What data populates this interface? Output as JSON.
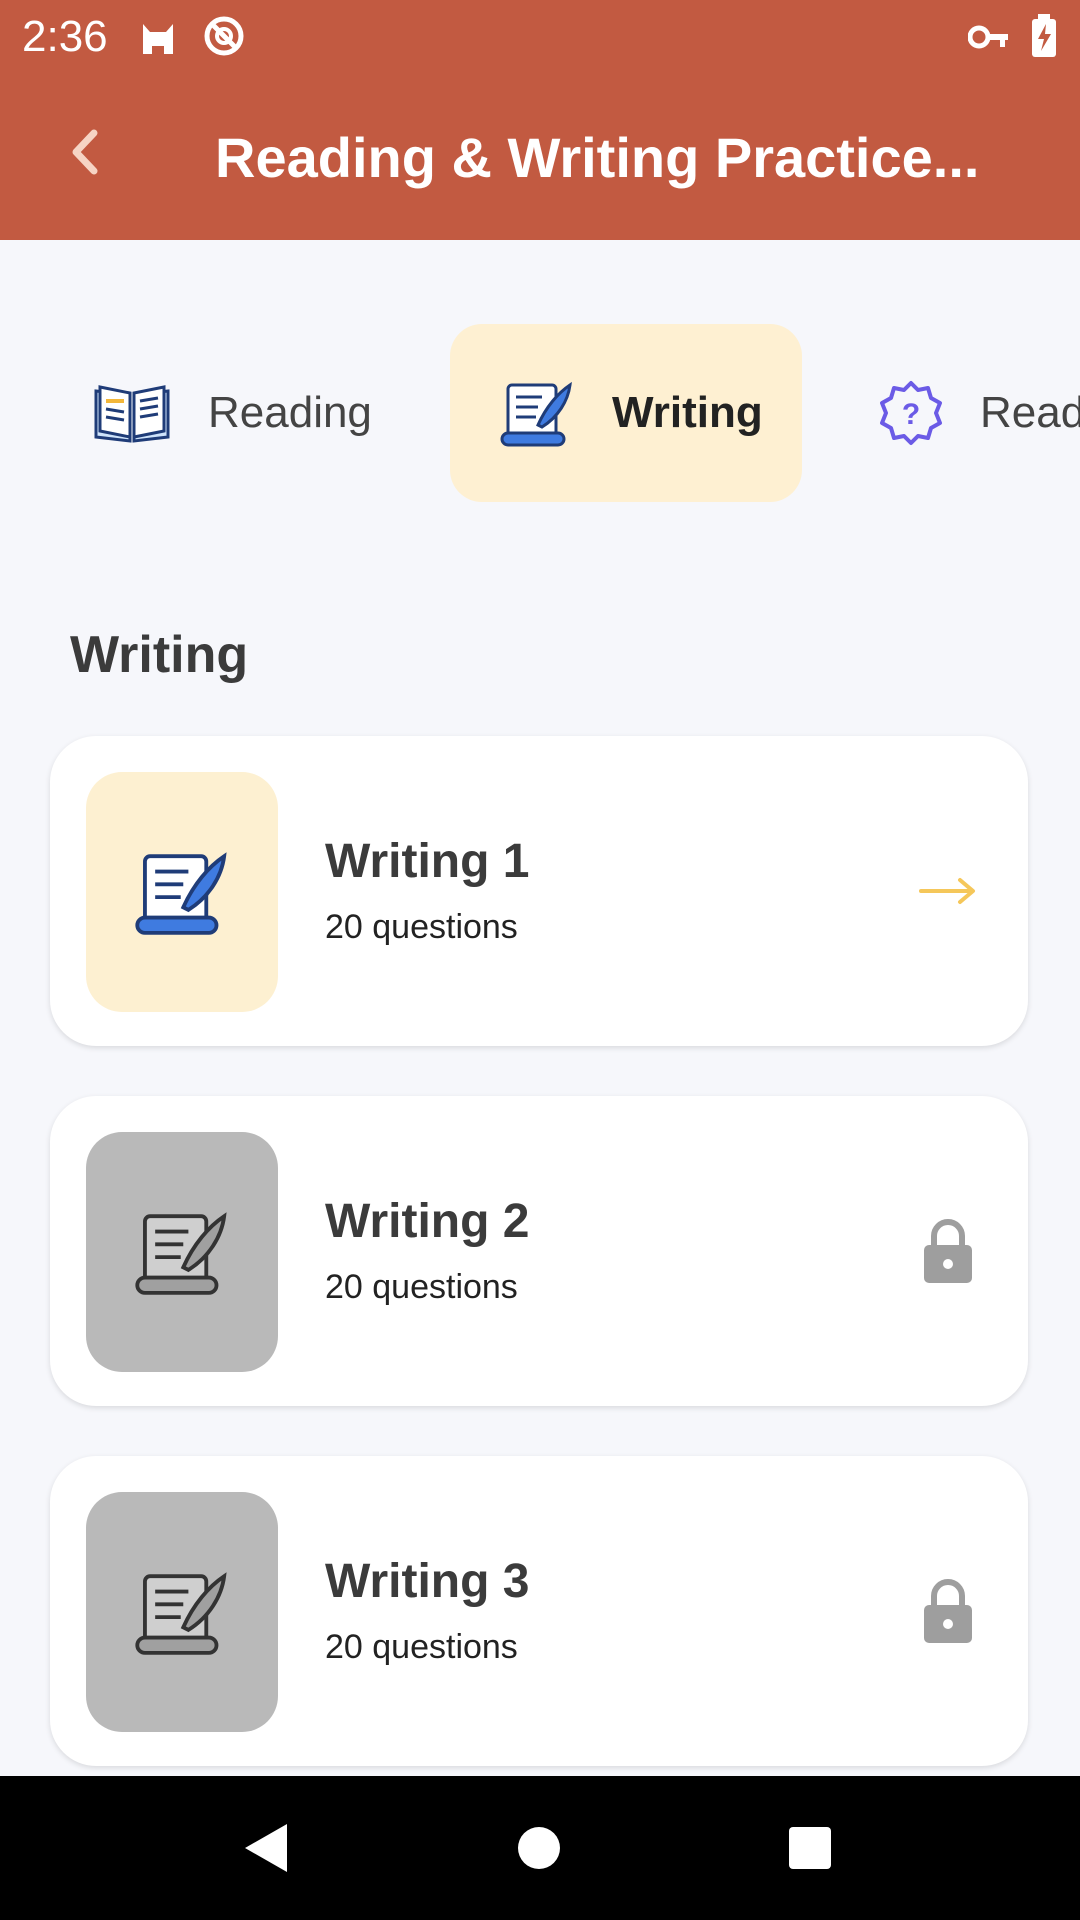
{
  "status_bar": {
    "time": "2:36"
  },
  "header": {
    "title": "Reading & Writing Practice..."
  },
  "tabs": [
    {
      "label": "Reading",
      "icon": "open-book-icon",
      "active": false
    },
    {
      "label": "Writing",
      "icon": "scroll-quill-icon",
      "active": true
    },
    {
      "label": "Read",
      "icon": "question-badge-icon",
      "active": false
    }
  ],
  "section": {
    "title": "Writing"
  },
  "lessons": [
    {
      "title": "Writing 1",
      "subtitle": "20 questions",
      "state": "unlocked",
      "trail_icon": "arrow-right-icon"
    },
    {
      "title": "Writing 2",
      "subtitle": "20 questions",
      "state": "locked",
      "trail_icon": "lock-icon"
    },
    {
      "title": "Writing 3",
      "subtitle": "20 questions",
      "state": "locked",
      "trail_icon": "lock-icon"
    }
  ],
  "colors": {
    "app_bar": "#c25a41",
    "active_tab_bg": "#fef0d2",
    "arrow": "#f5c75a",
    "locked_thumb": "#b9b9b9"
  }
}
